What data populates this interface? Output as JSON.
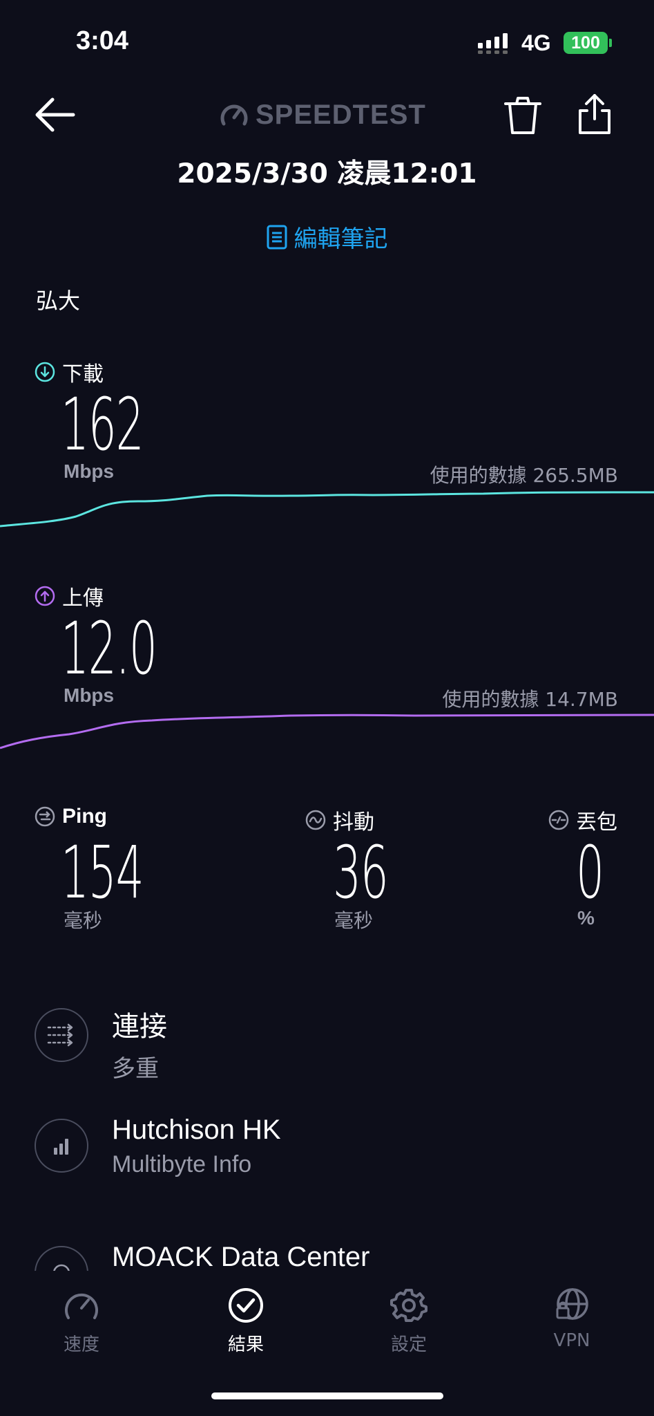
{
  "status_bar": {
    "time": "3:04",
    "network": "4G",
    "battery": "100"
  },
  "header": {
    "logo_text": "SPEEDTEST",
    "datetime": "2025/3/30 凌晨12:01",
    "edit_note_label": "編輯筆記"
  },
  "location": "弘大",
  "download": {
    "label": "下載",
    "value": "162",
    "unit": "Mbps",
    "data_used": "使用的數據 265.5MB"
  },
  "upload": {
    "label": "上傳",
    "value": "12.0",
    "unit": "Mbps",
    "data_used": "使用的數據 14.7MB"
  },
  "ping": {
    "label": "Ping",
    "value": "154",
    "unit": "毫秒"
  },
  "jitter": {
    "label": "抖動",
    "value": "36",
    "unit": "毫秒"
  },
  "packet_loss": {
    "label": "丟包",
    "value": "0",
    "unit": "%"
  },
  "details": [
    {
      "title": "連接",
      "subtitle": "多重",
      "icon": "connections-icon"
    },
    {
      "title": "Hutchison HK",
      "subtitle": "Multibyte Info",
      "icon": "signal-bars-icon"
    },
    {
      "title": "MOACK Data Center",
      "subtitle": "",
      "icon": "server-icon"
    }
  ],
  "tabs": [
    {
      "label": "速度",
      "icon": "speedometer-icon"
    },
    {
      "label": "結果",
      "icon": "check-circle-icon"
    },
    {
      "label": "設定",
      "icon": "gear-icon"
    },
    {
      "label": "VPN",
      "icon": "vpn-globe-icon"
    }
  ],
  "colors": {
    "background": "#0d0e1a",
    "download": "#5ce5e0",
    "upload": "#b36cf0",
    "accent": "#1fa4f0",
    "active_tab": "#ffffff"
  }
}
